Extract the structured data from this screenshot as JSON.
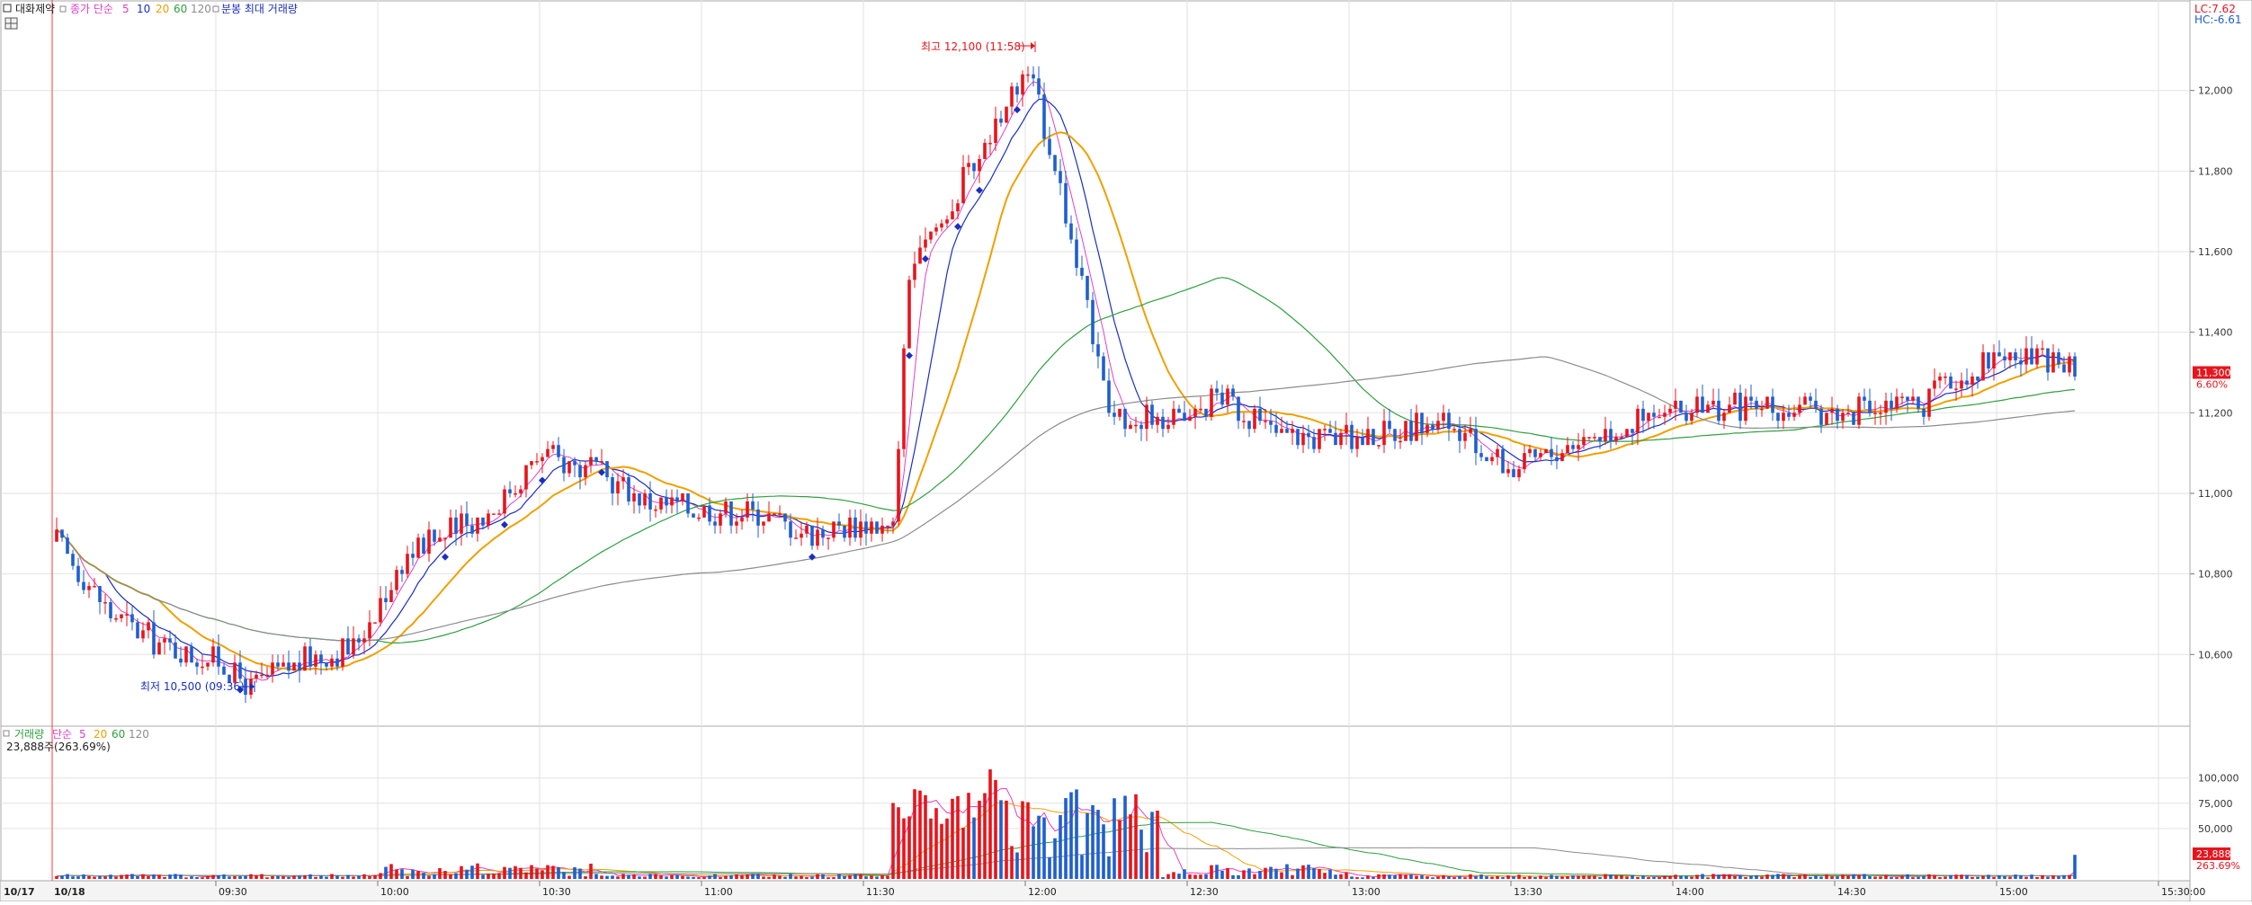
{
  "header": {
    "title": "대화제약",
    "ma_label": "종가 단순",
    "ma_periods": [
      "5",
      "10",
      "20",
      "60",
      "120"
    ],
    "extra_label": "분봉 최대 거래량"
  },
  "volume_header": {
    "title": "거래량",
    "ma_label": "단순",
    "ma_periods": [
      "5",
      "20",
      "60",
      "120"
    ],
    "current": "23,888주(263.69%)"
  },
  "corner": {
    "lc": "LC:7.62",
    "hc": "HC:-6.61"
  },
  "colors": {
    "up": "#e8141c",
    "down": "#1f5fcf",
    "ma5": "#e040c8",
    "ma10": "#1a2fbf",
    "ma20": "#f0a000",
    "ma60": "#2fa040",
    "ma120": "#8c8c8c"
  },
  "chart_data": [
    {
      "type": "candlestick",
      "ylim": [
        10440,
        12180
      ],
      "y_ticks": [
        10600,
        10800,
        11000,
        11200,
        11400,
        11600,
        11800,
        12000
      ],
      "y_tick_labels": [
        "10,600",
        "10,800",
        "11,000",
        "11,200",
        "11,400",
        "11,600",
        "11,800",
        "12,000"
      ],
      "x_ticks": [
        "10/17",
        "10/18",
        "09:30",
        "10:00",
        "10:30",
        "11:00",
        "11:30",
        "12:00",
        "12:30",
        "13:00",
        "13:30",
        "14:00",
        "14:30",
        "15:00",
        "15:30:00"
      ],
      "grid": true,
      "annotations": [
        {
          "text": "최고 12,100 (11:58)",
          "price": 12100,
          "time": "11:58"
        },
        {
          "text": "최저 10,500 (09:36)",
          "price": 10500,
          "time": "09:36"
        }
      ],
      "current_price": {
        "label": "11,300",
        "change": "6.60%",
        "value": 11300
      },
      "price_path": {
        "note": "approximate price path (time in minutes from 09:00 → close)",
        "t": [
          0,
          10,
          20,
          30,
          36,
          45,
          55,
          65,
          80,
          90,
          100,
          110,
          120,
          130,
          140,
          150,
          155,
          158,
          165,
          175,
          180,
          185,
          195,
          210,
          215,
          225,
          240,
          255,
          270,
          285,
          300,
          310,
          330,
          345,
          360,
          375
        ],
        "p": [
          10880,
          10700,
          10620,
          10580,
          10520,
          10580,
          10620,
          10850,
          10950,
          11100,
          11050,
          10980,
          10960,
          10950,
          10900,
          10930,
          10910,
          11550,
          11700,
          11950,
          12050,
          11820,
          11200,
          11180,
          11250,
          11150,
          11130,
          11180,
          11060,
          11150,
          11200,
          11220,
          11200,
          11220,
          11350,
          11300
        ]
      }
    },
    {
      "type": "bar",
      "title": "거래량",
      "ylim": [
        0,
        130000
      ],
      "y_ticks": [
        50000,
        75000,
        100000
      ],
      "y_tick_labels": [
        "50,000",
        "75,000",
        "100,000"
      ],
      "current_volume": {
        "label": "23,888",
        "ratio": "263.69%",
        "value": 23888
      }
    }
  ]
}
